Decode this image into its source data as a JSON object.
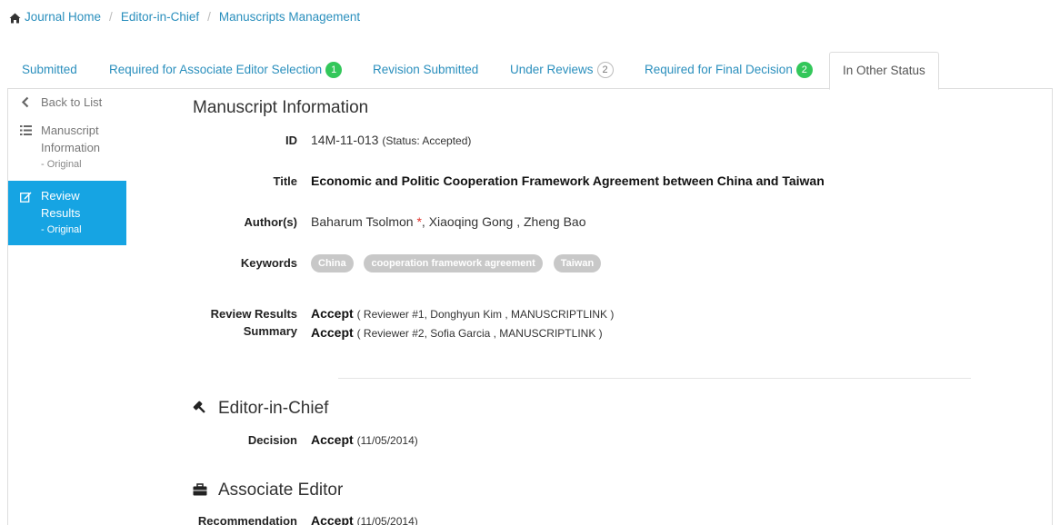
{
  "breadcrumb": {
    "home": "Journal Home",
    "level2": "Editor-in-Chief",
    "level3": "Manuscripts Management"
  },
  "tabs": [
    {
      "label": "Submitted",
      "badge": ""
    },
    {
      "label": "Required for Associate Editor Selection",
      "badge": "1"
    },
    {
      "label": "Revision Submitted",
      "badge": ""
    },
    {
      "label": "Under Reviews",
      "badge": "2"
    },
    {
      "label": "Required for Final Decision",
      "badge": "2"
    },
    {
      "label": "In Other Status",
      "badge": ""
    }
  ],
  "sidebar": {
    "back": "Back to List",
    "manuscript_info": "Manuscript Information",
    "manuscript_info_sub": "- Original",
    "review_results": "Review Results",
    "review_results_sub": "- Original"
  },
  "manuscript": {
    "section_title": "Manuscript Information",
    "id_label": "ID",
    "id_value": "14M-11-013",
    "status": "(Status: Accepted)",
    "title_label": "Title",
    "title_value": "Economic and Politic Cooperation Framework Agreement between China and Taiwan",
    "authors_label": "Author(s)",
    "author1": "Baharum Tsolmon",
    "author1_mark": "*",
    "authors_rest": ", Xiaoqing Gong , Zheng Bao",
    "keywords_label": "Keywords",
    "keywords": [
      "China",
      "cooperation framework agreement",
      "Taiwan"
    ],
    "review_summary_label_1": "Review Results",
    "review_summary_label_2": "Summary",
    "review1_decision": "Accept",
    "review1_detail": "( Reviewer #1, Donghyun Kim , MANUSCRIPTLINK )",
    "review2_decision": "Accept",
    "review2_detail": "( Reviewer #2, Sofia Garcia , MANUSCRIPTLINK )"
  },
  "eic": {
    "title": "Editor-in-Chief",
    "decision_label": "Decision",
    "decision_value": "Accept",
    "decision_date": "(11/05/2014)"
  },
  "ae": {
    "title": "Associate Editor",
    "rec_label": "Recommendation",
    "rec_value": "Accept",
    "rec_date": "(11/05/2014)"
  }
}
